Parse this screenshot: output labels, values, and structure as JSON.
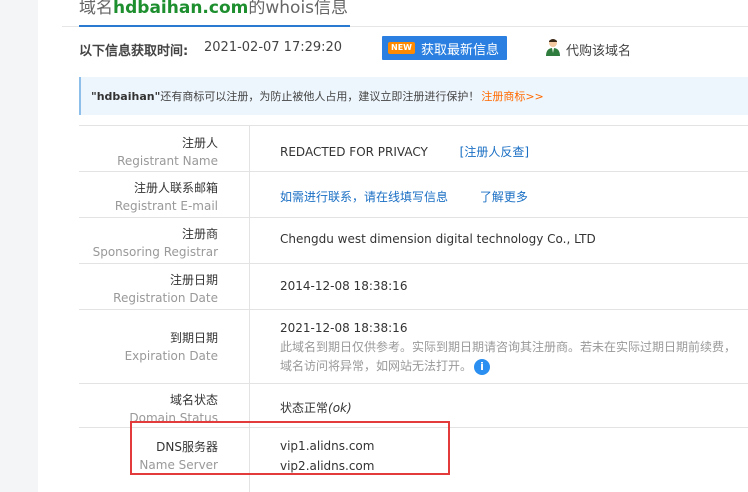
{
  "header": {
    "title_prefix": "域名",
    "domain": "hdbaihan.com",
    "title_suffix": "的whois信息"
  },
  "info_bar": {
    "label": "以下信息获取时间:",
    "time": "2021-02-07 17:29:20",
    "new_badge": "NEW",
    "refresh_label": "获取最新信息",
    "agent_label": "代购该域名"
  },
  "notice": {
    "brand": "\"hdbaihan\"",
    "text": " 还有商标可以注册，为防止被他人占用，建议立即注册进行保护！",
    "link": "注册商标>>"
  },
  "rows": {
    "registrant": {
      "cn": "注册人",
      "en": "Registrant Name",
      "value": "REDACTED FOR PRIVACY",
      "link": "[注册人反查]"
    },
    "email": {
      "cn": "注册人联系邮箱",
      "en": "Registrant E-mail",
      "link1": "如需进行联系，请在线填写信息",
      "link2": "了解更多"
    },
    "registrar": {
      "cn": "注册商",
      "en": "Sponsoring Registrar",
      "value": "Chengdu west dimension digital technology Co., LTD"
    },
    "reg_date": {
      "cn": "注册日期",
      "en": "Registration Date",
      "value": "2014-12-08 18:38:16"
    },
    "exp_date": {
      "cn": "到期日期",
      "en": "Expiration Date",
      "value": "2021-12-08 18:38:16",
      "note1": "此域名到期日仅供参考。实际到期日期请咨询其注册商。若未在实际过期日期前续费，",
      "note2": "域名访问将异常，如网站无法打开。",
      "info_icon": "i"
    },
    "status": {
      "cn": "域名状态",
      "en": "Domain Status",
      "value": "状态正常",
      "code": "(ok)"
    },
    "dns": {
      "cn": "DNS服务器",
      "en": "Name Server",
      "ns1": "vip1.alidns.com",
      "ns2": "vip2.alidns.com"
    }
  },
  "colors": {
    "accent": "#2a7fe0",
    "domain_green": "#1e8f2e",
    "highlight_red": "#e33b3b",
    "link_orange": "#ff6a00"
  }
}
